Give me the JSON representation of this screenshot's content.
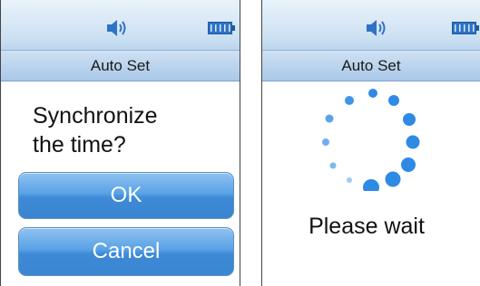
{
  "screens": [
    {
      "title": "Auto Set",
      "question_line1": "Synchronize",
      "question_line2": "the time?",
      "ok_label": "OK",
      "cancel_label": "Cancel"
    },
    {
      "title": "Auto Set",
      "wait_label": "Please wait"
    }
  ],
  "icons": {
    "sound": "speaker-icon",
    "battery": "battery-icon"
  },
  "colors": {
    "accent": "#3e8ad6",
    "header_light": "#e9f3fb",
    "header_mid": "#bcd6ee",
    "spinner": "#2f8ae6"
  }
}
